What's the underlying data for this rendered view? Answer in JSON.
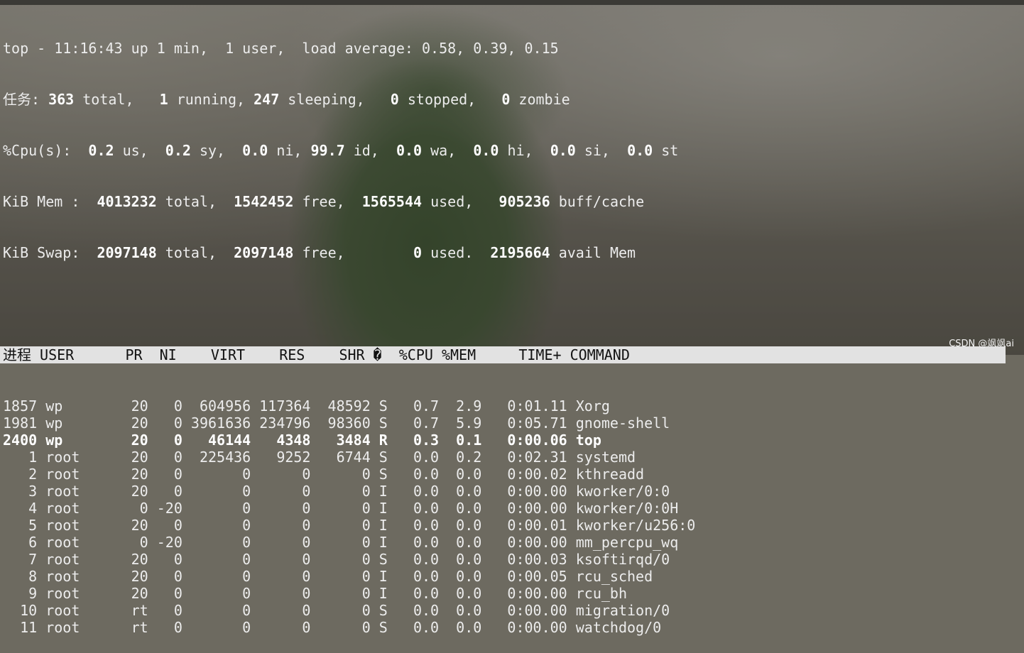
{
  "summary": {
    "line1": "top - 11:16:43 up 1 min,  1 user,  load average: 0.58, 0.39, 0.15",
    "tasks": [
      {
        "t": "任务:",
        "b": false
      },
      {
        "t": " 363",
        "b": true
      },
      {
        "t": " total,   ",
        "b": false
      },
      {
        "t": "1",
        "b": true
      },
      {
        "t": " running, ",
        "b": false
      },
      {
        "t": "247",
        "b": true
      },
      {
        "t": " sleeping,   ",
        "b": false
      },
      {
        "t": "0",
        "b": true
      },
      {
        "t": " stopped,   ",
        "b": false
      },
      {
        "t": "0",
        "b": true
      },
      {
        "t": " zombie",
        "b": false
      }
    ],
    "cpu": [
      {
        "t": "%Cpu(s):  ",
        "b": false
      },
      {
        "t": "0.2",
        "b": true
      },
      {
        "t": " us,  ",
        "b": false
      },
      {
        "t": "0.2",
        "b": true
      },
      {
        "t": " sy,  ",
        "b": false
      },
      {
        "t": "0.0",
        "b": true
      },
      {
        "t": " ni, ",
        "b": false
      },
      {
        "t": "99.7",
        "b": true
      },
      {
        "t": " id,  ",
        "b": false
      },
      {
        "t": "0.0",
        "b": true
      },
      {
        "t": " wa,  ",
        "b": false
      },
      {
        "t": "0.0",
        "b": true
      },
      {
        "t": " hi,  ",
        "b": false
      },
      {
        "t": "0.0",
        "b": true
      },
      {
        "t": " si,  ",
        "b": false
      },
      {
        "t": "0.0",
        "b": true
      },
      {
        "t": " st",
        "b": false
      }
    ],
    "mem": [
      {
        "t": "KiB Mem :  ",
        "b": false
      },
      {
        "t": "4013232",
        "b": true
      },
      {
        "t": " total,  ",
        "b": false
      },
      {
        "t": "1542452",
        "b": true
      },
      {
        "t": " free,  ",
        "b": false
      },
      {
        "t": "1565544",
        "b": true
      },
      {
        "t": " used,   ",
        "b": false
      },
      {
        "t": "905236",
        "b": true
      },
      {
        "t": " buff/cache",
        "b": false
      }
    ],
    "swap": [
      {
        "t": "KiB Swap:  ",
        "b": false
      },
      {
        "t": "2097148",
        "b": true
      },
      {
        "t": " total,  ",
        "b": false
      },
      {
        "t": "2097148",
        "b": true
      },
      {
        "t": " free,        ",
        "b": false
      },
      {
        "t": "0",
        "b": true
      },
      {
        "t": " used.  ",
        "b": false
      },
      {
        "t": "2195664",
        "b": true
      },
      {
        "t": " avail Mem",
        "b": false
      }
    ]
  },
  "table": {
    "header": "进程 USER      PR  NI    VIRT    RES    SHR �  %CPU %MEM     TIME+ COMMAND",
    "rows": [
      {
        "pid": "1857",
        "user": "wp",
        "pr": "20",
        "ni": "0",
        "virt": "604956",
        "res": "117364",
        "shr": "48592",
        "s": "S",
        "cpu": "0.7",
        "mem": "2.9",
        "time": "0:01.11",
        "cmd": "Xorg",
        "bold": false
      },
      {
        "pid": "1981",
        "user": "wp",
        "pr": "20",
        "ni": "0",
        "virt": "3961636",
        "res": "234796",
        "shr": "98360",
        "s": "S",
        "cpu": "0.7",
        "mem": "5.9",
        "time": "0:05.71",
        "cmd": "gnome-shell",
        "bold": false
      },
      {
        "pid": "2400",
        "user": "wp",
        "pr": "20",
        "ni": "0",
        "virt": "46144",
        "res": "4348",
        "shr": "3484",
        "s": "R",
        "cpu": "0.3",
        "mem": "0.1",
        "time": "0:00.06",
        "cmd": "top",
        "bold": true
      },
      {
        "pid": "1",
        "user": "root",
        "pr": "20",
        "ni": "0",
        "virt": "225436",
        "res": "9252",
        "shr": "6744",
        "s": "S",
        "cpu": "0.0",
        "mem": "0.2",
        "time": "0:02.31",
        "cmd": "systemd",
        "bold": false
      },
      {
        "pid": "2",
        "user": "root",
        "pr": "20",
        "ni": "0",
        "virt": "0",
        "res": "0",
        "shr": "0",
        "s": "S",
        "cpu": "0.0",
        "mem": "0.0",
        "time": "0:00.02",
        "cmd": "kthreadd",
        "bold": false
      },
      {
        "pid": "3",
        "user": "root",
        "pr": "20",
        "ni": "0",
        "virt": "0",
        "res": "0",
        "shr": "0",
        "s": "I",
        "cpu": "0.0",
        "mem": "0.0",
        "time": "0:00.00",
        "cmd": "kworker/0:0",
        "bold": false
      },
      {
        "pid": "4",
        "user": "root",
        "pr": "0",
        "ni": "-20",
        "virt": "0",
        "res": "0",
        "shr": "0",
        "s": "I",
        "cpu": "0.0",
        "mem": "0.0",
        "time": "0:00.00",
        "cmd": "kworker/0:0H",
        "bold": false
      },
      {
        "pid": "5",
        "user": "root",
        "pr": "20",
        "ni": "0",
        "virt": "0",
        "res": "0",
        "shr": "0",
        "s": "I",
        "cpu": "0.0",
        "mem": "0.0",
        "time": "0:00.01",
        "cmd": "kworker/u256:0",
        "bold": false
      },
      {
        "pid": "6",
        "user": "root",
        "pr": "0",
        "ni": "-20",
        "virt": "0",
        "res": "0",
        "shr": "0",
        "s": "I",
        "cpu": "0.0",
        "mem": "0.0",
        "time": "0:00.00",
        "cmd": "mm_percpu_wq",
        "bold": false
      },
      {
        "pid": "7",
        "user": "root",
        "pr": "20",
        "ni": "0",
        "virt": "0",
        "res": "0",
        "shr": "0",
        "s": "S",
        "cpu": "0.0",
        "mem": "0.0",
        "time": "0:00.03",
        "cmd": "ksoftirqd/0",
        "bold": false
      },
      {
        "pid": "8",
        "user": "root",
        "pr": "20",
        "ni": "0",
        "virt": "0",
        "res": "0",
        "shr": "0",
        "s": "I",
        "cpu": "0.0",
        "mem": "0.0",
        "time": "0:00.05",
        "cmd": "rcu_sched",
        "bold": false
      },
      {
        "pid": "9",
        "user": "root",
        "pr": "20",
        "ni": "0",
        "virt": "0",
        "res": "0",
        "shr": "0",
        "s": "I",
        "cpu": "0.0",
        "mem": "0.0",
        "time": "0:00.00",
        "cmd": "rcu_bh",
        "bold": false
      },
      {
        "pid": "10",
        "user": "root",
        "pr": "rt",
        "ni": "0",
        "virt": "0",
        "res": "0",
        "shr": "0",
        "s": "S",
        "cpu": "0.0",
        "mem": "0.0",
        "time": "0:00.00",
        "cmd": "migration/0",
        "bold": false
      },
      {
        "pid": "11",
        "user": "root",
        "pr": "rt",
        "ni": "0",
        "virt": "0",
        "res": "0",
        "shr": "0",
        "s": "S",
        "cpu": "0.0",
        "mem": "0.0",
        "time": "0:00.00",
        "cmd": "watchdog/0",
        "bold": false
      }
    ]
  },
  "watermark": "CSDN @飒飒ai"
}
